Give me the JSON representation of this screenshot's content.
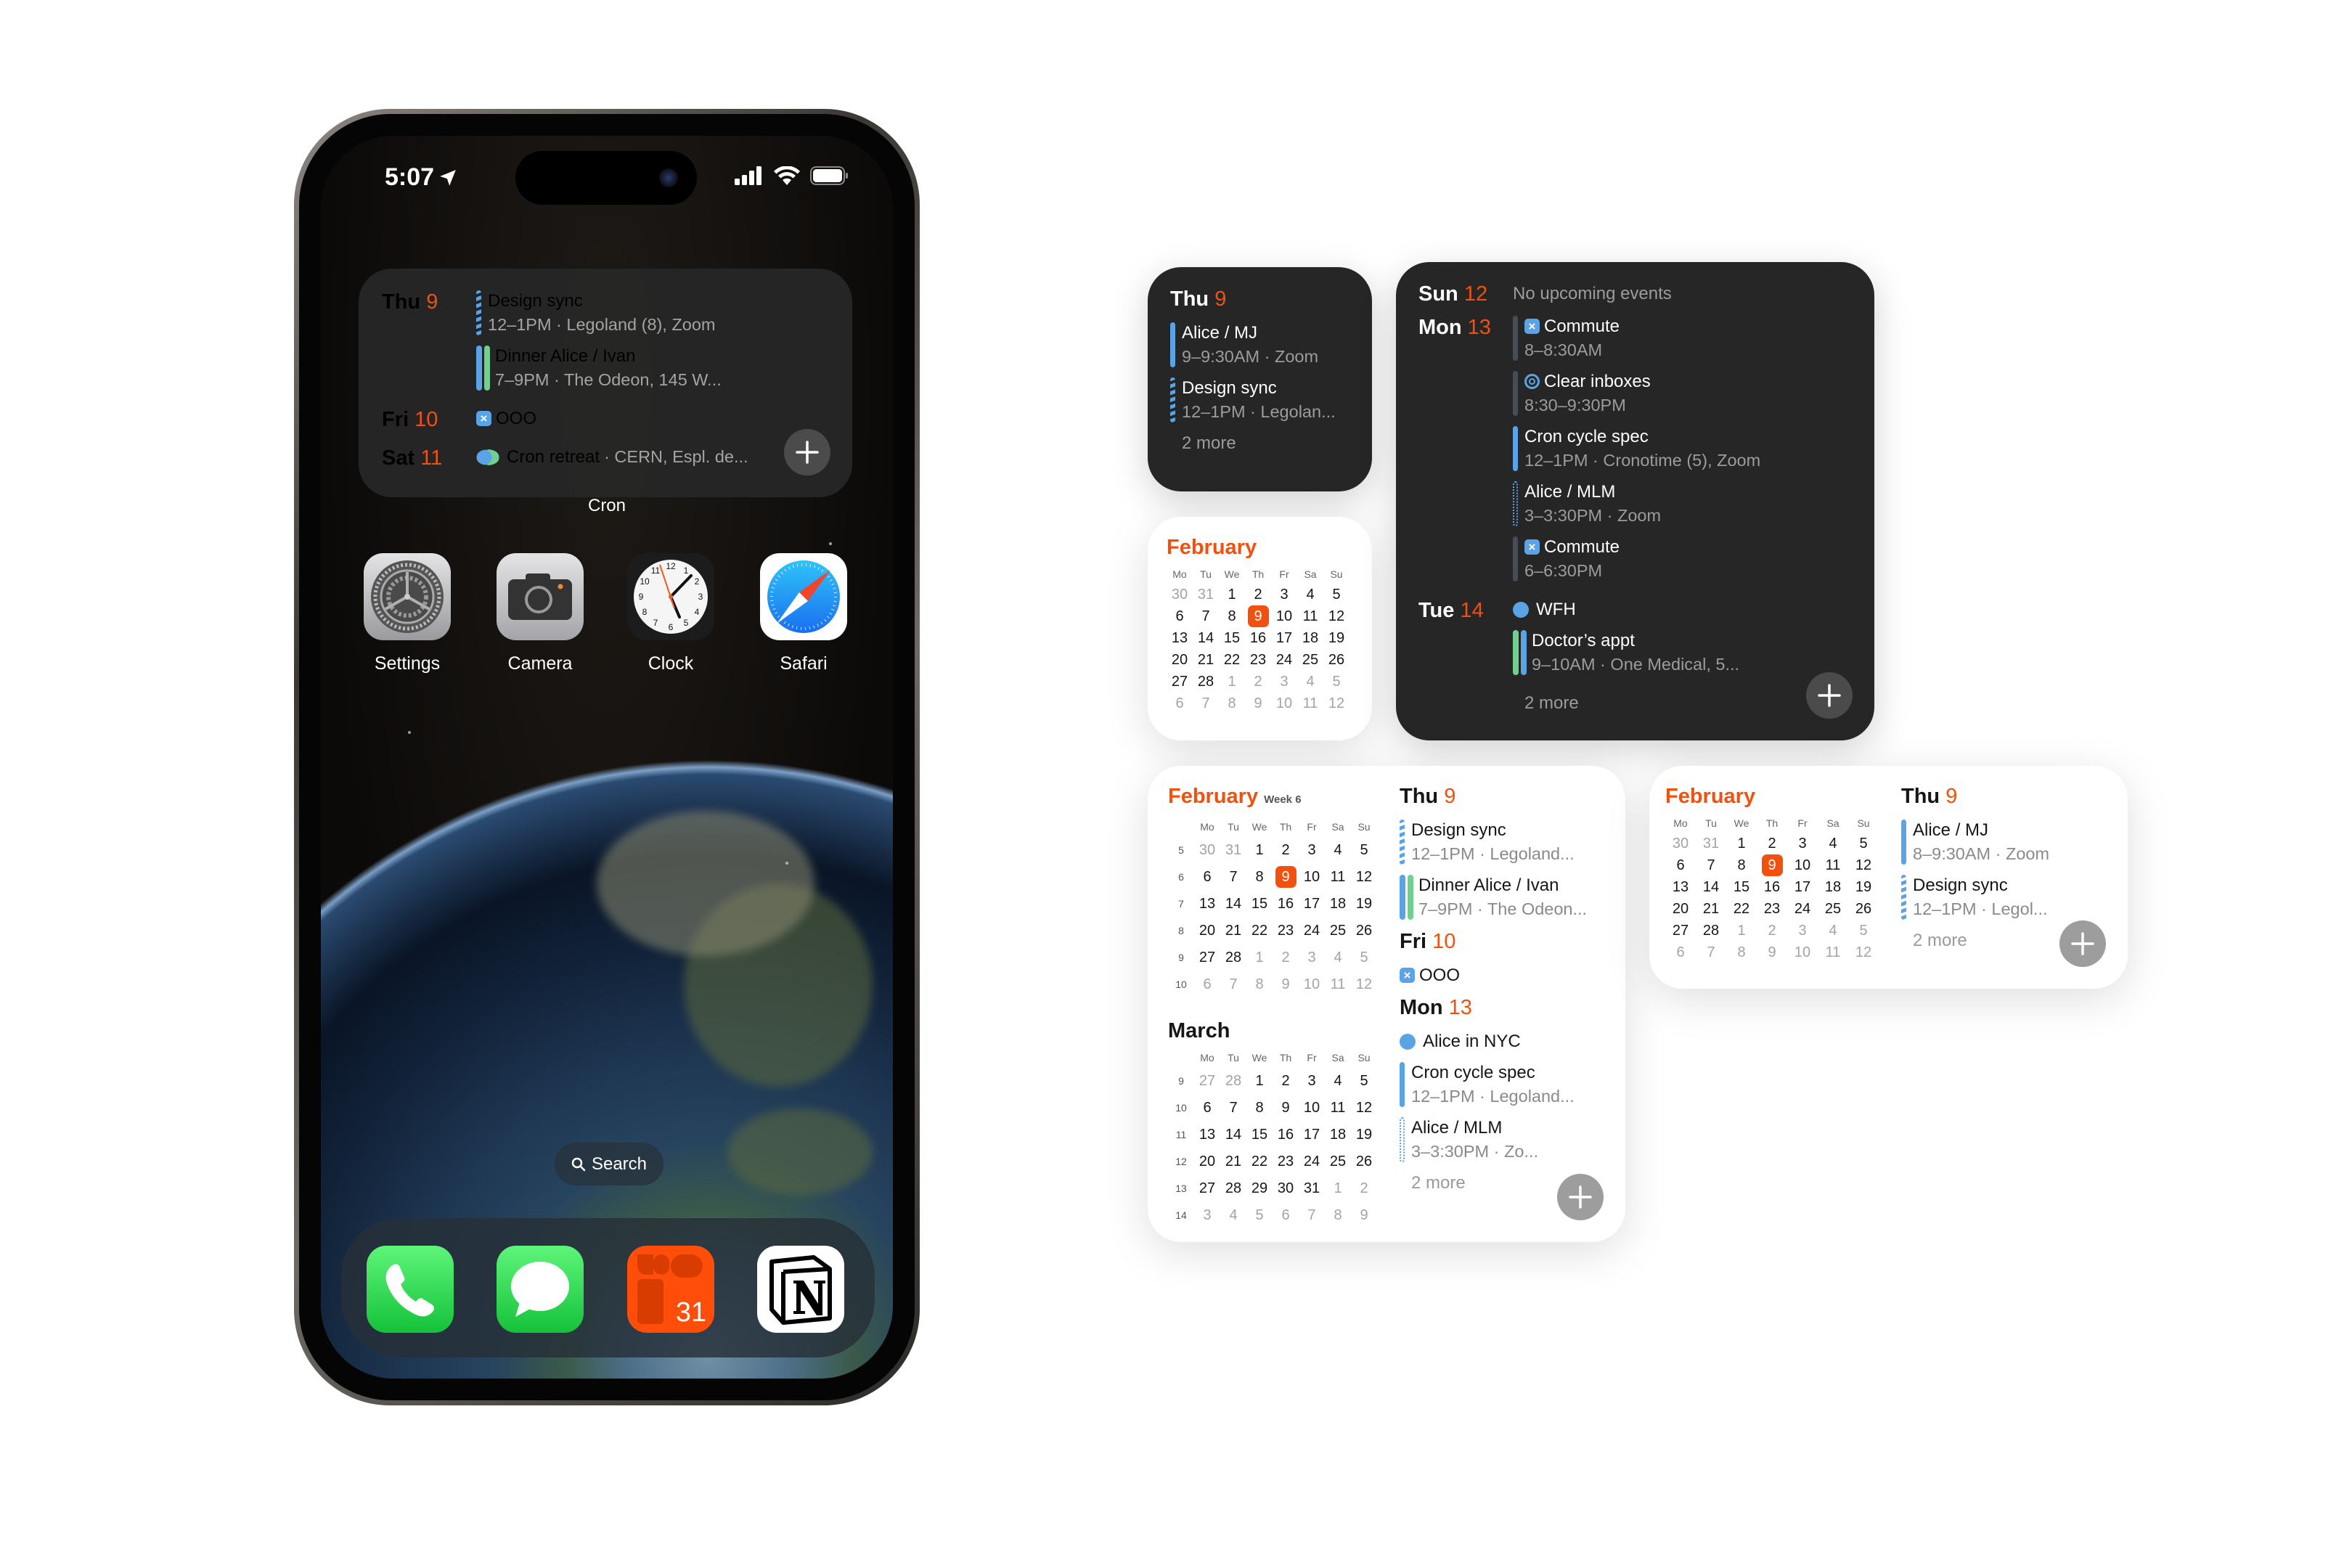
{
  "colors": {
    "accent": "#f2500f",
    "event_blue": "#5aa4e6",
    "event_green": "#6fd08f",
    "dark_widget": "#262626",
    "light_widget": "#ffffff"
  },
  "phone": {
    "status": {
      "time": "5:07",
      "icons": [
        "location-arrow-icon",
        "cellular-signal-icon",
        "wifi-icon",
        "battery-icon"
      ]
    },
    "widget": {
      "label": "Cron",
      "sections": [
        {
          "day": "Thu",
          "num": "9",
          "events": [
            {
              "marker": "striped",
              "title": "Design sync",
              "sub": "12–1PM · Legoland (8), Zoom"
            },
            {
              "marker": "double",
              "title": "Dinner Alice / Ivan",
              "sub": "7–9PM · The Odeon, 145 W..."
            }
          ]
        },
        {
          "day": "Fri",
          "num": "10",
          "events": [
            {
              "marker": "none",
              "icon": "x-box-icon",
              "title": "OOO"
            }
          ]
        },
        {
          "day": "Sat",
          "num": "11",
          "events": [
            {
              "marker": "dot-double",
              "title": "Cron retreat",
              "inline_sub": "· CERN, Espl. de..."
            }
          ]
        }
      ]
    },
    "apps": [
      {
        "label": "Settings",
        "icon": "settings-icon"
      },
      {
        "label": "Camera",
        "icon": "camera-icon"
      },
      {
        "label": "Clock",
        "icon": "clock-icon"
      },
      {
        "label": "Safari",
        "icon": "safari-icon"
      }
    ],
    "search_label": "Search",
    "dock": [
      {
        "icon": "phone-icon"
      },
      {
        "icon": "messages-icon"
      },
      {
        "icon": "cron-calendar-icon",
        "badge_text": "31"
      },
      {
        "icon": "notion-icon"
      }
    ]
  },
  "widgets": {
    "small_dark": {
      "sections": [
        {
          "day": "Thu",
          "num": "9",
          "events": [
            {
              "marker": "bar",
              "title": "Alice / MJ",
              "sub": "9–9:30AM · Zoom"
            },
            {
              "marker": "striped",
              "title": "Design sync",
              "sub": "12–1PM · Legolan..."
            }
          ]
        }
      ],
      "more": "2 more"
    },
    "small_light": {
      "months": [
        {
          "name": "February",
          "weekdays": [
            "Mo",
            "Tu",
            "We",
            "Th",
            "Fr",
            "Sa",
            "Su"
          ],
          "rows": [
            [
              {
                "d": 30,
                "muted": true
              },
              {
                "d": 31,
                "muted": true
              },
              1,
              2,
              3,
              4,
              5
            ],
            [
              6,
              7,
              8,
              {
                "d": 9,
                "today": true
              },
              10,
              11,
              12
            ],
            [
              13,
              14,
              15,
              16,
              17,
              18,
              19
            ],
            [
              20,
              21,
              22,
              23,
              24,
              25,
              26
            ],
            [
              27,
              28,
              {
                "d": 1,
                "muted": true
              },
              {
                "d": 2,
                "muted": true
              },
              {
                "d": 3,
                "muted": true
              },
              {
                "d": 4,
                "muted": true
              },
              {
                "d": 5,
                "muted": true
              }
            ],
            [
              {
                "d": 6,
                "muted": true
              },
              {
                "d": 7,
                "muted": true
              },
              {
                "d": 8,
                "muted": true
              },
              {
                "d": 9,
                "muted": true
              },
              {
                "d": 10,
                "muted": true
              },
              {
                "d": 11,
                "muted": true
              },
              {
                "d": 12,
                "muted": true
              }
            ]
          ]
        }
      ]
    },
    "large_dark": {
      "sections": [
        {
          "day": "Sun",
          "num": "12",
          "note": "No upcoming events",
          "events": []
        },
        {
          "day": "Mon",
          "num": "13",
          "events": [
            {
              "marker": "dark",
              "icon": "x-box-icon",
              "title": "Commute",
              "sub": "8–8:30AM"
            },
            {
              "marker": "dark",
              "icon": "target-icon",
              "title": "Clear inboxes",
              "sub": "8:30–9:30PM"
            },
            {
              "marker": "bar",
              "title": "Cron cycle spec",
              "sub": "12–1PM · Cronotime (5), Zoom"
            },
            {
              "marker": "dotted",
              "title": "Alice / MLM",
              "sub": "3–3:30PM · Zoom"
            },
            {
              "marker": "dark",
              "icon": "x-box-icon",
              "title": "Commute",
              "sub": "6–6:30PM"
            }
          ]
        },
        {
          "day": "Tue",
          "num": "14",
          "events": [
            {
              "marker": "dot",
              "title": "WFH"
            },
            {
              "marker": "double-gb",
              "title": "Doctor’s appt",
              "sub": "9–10AM · One Medical, 5..."
            }
          ]
        }
      ],
      "more": "2 more"
    },
    "large_light": {
      "months": [
        {
          "name": "February",
          "week_label": "Week 6",
          "weekdays": [
            "Mo",
            "Tu",
            "We",
            "Th",
            "Fr",
            "Sa",
            "Su"
          ],
          "week_numbers": [
            5,
            6,
            7,
            8,
            9,
            10
          ],
          "rows": [
            [
              {
                "d": 30,
                "muted": true
              },
              {
                "d": 31,
                "muted": true
              },
              1,
              2,
              3,
              4,
              5
            ],
            [
              6,
              7,
              8,
              {
                "d": 9,
                "today": true
              },
              10,
              11,
              12
            ],
            [
              13,
              14,
              15,
              16,
              17,
              18,
              19
            ],
            [
              20,
              21,
              22,
              23,
              24,
              25,
              26
            ],
            [
              27,
              28,
              {
                "d": 1,
                "muted": true
              },
              {
                "d": 2,
                "muted": true
              },
              {
                "d": 3,
                "muted": true
              },
              {
                "d": 4,
                "muted": true
              },
              {
                "d": 5,
                "muted": true
              }
            ],
            [
              {
                "d": 6,
                "muted": true
              },
              {
                "d": 7,
                "muted": true
              },
              {
                "d": 8,
                "muted": true
              },
              {
                "d": 9,
                "muted": true
              },
              {
                "d": 10,
                "muted": true
              },
              {
                "d": 11,
                "muted": true
              },
              {
                "d": 12,
                "muted": true
              }
            ]
          ]
        },
        {
          "name": "March",
          "weekdays": [
            "Mo",
            "Tu",
            "We",
            "Th",
            "Fr",
            "Sa",
            "Su"
          ],
          "week_numbers": [
            9,
            10,
            11,
            12,
            13,
            14
          ],
          "rows": [
            [
              {
                "d": 27,
                "muted": true
              },
              {
                "d": 28,
                "muted": true
              },
              1,
              2,
              3,
              4,
              5
            ],
            [
              6,
              7,
              8,
              9,
              10,
              11,
              12
            ],
            [
              13,
              14,
              15,
              16,
              17,
              18,
              19
            ],
            [
              20,
              21,
              22,
              23,
              24,
              25,
              26
            ],
            [
              27,
              28,
              29,
              30,
              31,
              {
                "d": 1,
                "muted": true
              },
              {
                "d": 2,
                "muted": true
              }
            ],
            [
              {
                "d": 3,
                "muted": true
              },
              {
                "d": 4,
                "muted": true
              },
              {
                "d": 5,
                "muted": true
              },
              {
                "d": 6,
                "muted": true
              },
              {
                "d": 7,
                "muted": true
              },
              {
                "d": 8,
                "muted": true
              },
              {
                "d": 9,
                "muted": true
              }
            ]
          ]
        }
      ],
      "sections": [
        {
          "day": "Thu",
          "num": "9",
          "events": [
            {
              "marker": "striped",
              "title": "Design sync",
              "sub": "12–1PM · Legoland..."
            },
            {
              "marker": "double",
              "title": "Dinner Alice / Ivan",
              "sub": "7–9PM · The Odeon..."
            }
          ]
        },
        {
          "day": "Fri",
          "num": "10",
          "events": [
            {
              "marker": "none",
              "icon": "x-box-icon",
              "title": "OOO"
            }
          ]
        },
        {
          "day": "Mon",
          "num": "13",
          "events": [
            {
              "marker": "dot",
              "title": "Alice in NYC"
            },
            {
              "marker": "bar",
              "title": "Cron cycle spec",
              "sub": "12–1PM · Legoland..."
            },
            {
              "marker": "dotted",
              "title": "Alice / MLM",
              "sub": "3–3:30PM · Zo..."
            }
          ]
        }
      ],
      "more": "2 more"
    },
    "medium_light": {
      "months": [
        {
          "name": "February",
          "weekdays": [
            "Mo",
            "Tu",
            "We",
            "Th",
            "Fr",
            "Sa",
            "Su"
          ],
          "rows": [
            [
              {
                "d": 30,
                "muted": true
              },
              {
                "d": 31,
                "muted": true
              },
              1,
              2,
              3,
              4,
              5
            ],
            [
              6,
              7,
              8,
              {
                "d": 9,
                "today": true
              },
              10,
              11,
              12
            ],
            [
              13,
              14,
              15,
              16,
              17,
              18,
              19
            ],
            [
              20,
              21,
              22,
              23,
              24,
              25,
              26
            ],
            [
              27,
              28,
              {
                "d": 1,
                "muted": true
              },
              {
                "d": 2,
                "muted": true
              },
              {
                "d": 3,
                "muted": true
              },
              {
                "d": 4,
                "muted": true
              },
              {
                "d": 5,
                "muted": true
              }
            ],
            [
              {
                "d": 6,
                "muted": true
              },
              {
                "d": 7,
                "muted": true
              },
              {
                "d": 8,
                "muted": true
              },
              {
                "d": 9,
                "muted": true
              },
              {
                "d": 10,
                "muted": true
              },
              {
                "d": 11,
                "muted": true
              },
              {
                "d": 12,
                "muted": true
              }
            ]
          ]
        }
      ],
      "sections": [
        {
          "day": "Thu",
          "num": "9",
          "events": [
            {
              "marker": "bar",
              "title": "Alice / MJ",
              "sub": "8–9:30AM · Zoom"
            },
            {
              "marker": "striped",
              "title": "Design sync",
              "sub": "12–1PM · Legol..."
            }
          ]
        }
      ],
      "more": "2 more"
    }
  }
}
